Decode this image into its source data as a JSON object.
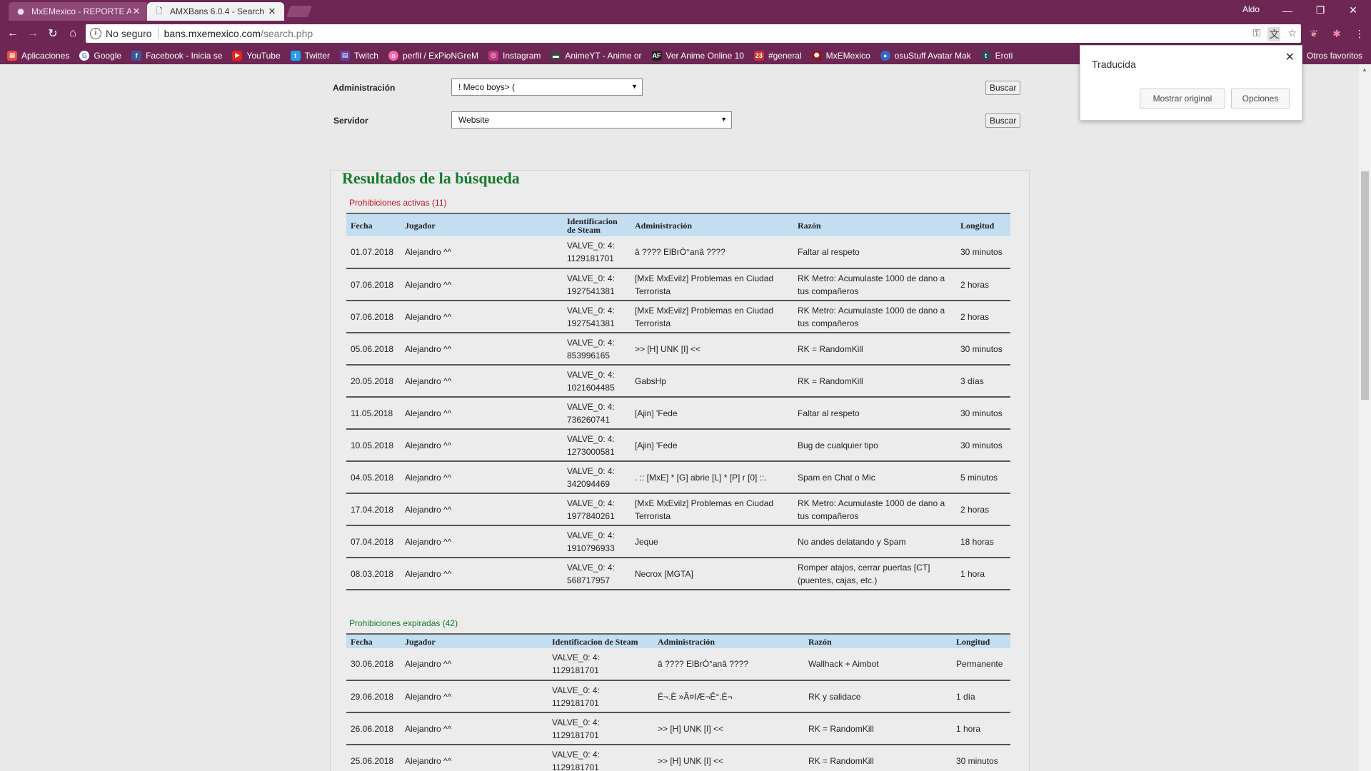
{
  "browser": {
    "tabs": [
      {
        "title": "MxEMexico - REPORTE A",
        "active": false
      },
      {
        "title": "AMXBans 6.0.4 - Search",
        "active": true
      }
    ],
    "profile_name": "Aldo",
    "security_label": "No seguro",
    "url_host": "bans.mxemexico.com",
    "url_path": "/search.php",
    "bookmarks": [
      {
        "label": "Aplicaciones",
        "icon": "apps-icon",
        "color": "#e94b3c"
      },
      {
        "label": "Google",
        "icon": "google-icon",
        "color": "#4285f4"
      },
      {
        "label": "Facebook - Inicia se",
        "icon": "facebook-icon",
        "color": "#3b5998"
      },
      {
        "label": "YouTube",
        "icon": "youtube-icon",
        "color": "#e62117"
      },
      {
        "label": "Twitter",
        "icon": "twitter-icon",
        "color": "#1da1f2"
      },
      {
        "label": "Twitch",
        "icon": "twitch-icon",
        "color": "#6441a4"
      },
      {
        "label": "perfil / ExPioNGreM",
        "icon": "osu-icon",
        "color": "#ff66aa"
      },
      {
        "label": "Instagram",
        "icon": "instagram-icon",
        "color": "#c13584"
      },
      {
        "label": "AnimeYT - Anime or",
        "icon": "animeyt-icon",
        "color": "#444444"
      },
      {
        "label": "Ver Anime Online 10",
        "icon": "animeflv-icon",
        "color": "#222222"
      },
      {
        "label": "#general",
        "icon": "discord-icon",
        "color": "#c83232"
      },
      {
        "label": "MxEMexico",
        "icon": "mxe-icon",
        "color": "#8b1a1a"
      },
      {
        "label": "osuStuff Avatar Mak",
        "icon": "osustuff-icon",
        "color": "#3366cc"
      },
      {
        "label": "Eroti",
        "icon": "tumblr-icon",
        "color": "#35465c"
      }
    ],
    "other_bookmarks": "Otros favoritos"
  },
  "translate_popup": {
    "title": "Traducida",
    "show_original": "Mostrar original",
    "options": "Opciones"
  },
  "search_form": {
    "admin_label": "Administración",
    "admin_value": "! Meco boys> (",
    "server_label": "Servidor",
    "server_value": "Website",
    "search_button": "Buscar"
  },
  "results": {
    "title": "Resultados de la búsqueda",
    "active_title": "Prohibiciones activas (11)",
    "expired_title": "Prohibiciones expiradas (42)",
    "active_headers": [
      "Fecha",
      "Jugador",
      "Identificacion de Steam",
      "Administración",
      "Razón",
      "Longitud"
    ],
    "expired_headers": [
      "Fecha",
      "Jugador",
      "Identificacion de Steam",
      "Administración",
      "Razón",
      "Longitud"
    ],
    "active_rows": [
      [
        "01.07.2018",
        "Alejandro ^^",
        "VALVE_0: 4: 1129181701",
        "â ???? ElBrÒ°anâ ????",
        "Faltar al respeto",
        "30 minutos"
      ],
      [
        "07.06.2018",
        "Alejandro ^^",
        "VALVE_0: 4: 1927541381",
        "[MxE MxEvilz] Problemas en Ciudad Terrorista",
        "RK Metro: Acumulaste 1000 de dano a tus compañeros",
        "2 horas"
      ],
      [
        "07.06.2018",
        "Alejandro ^^",
        "VALVE_0: 4: 1927541381",
        "[MxE MxEvilz] Problemas en Ciudad Terrorista",
        "RK Metro: Acumulaste 1000 de dano a tus compañeros",
        "2 horas"
      ],
      [
        "05.06.2018",
        "Alejandro ^^",
        "VALVE_0: 4: 853996165",
        ">> [H] UNK [I] <<",
        "RK = RandomKill",
        "30 minutos"
      ],
      [
        "20.05.2018",
        "Alejandro ^^",
        "VALVE_0: 4: 1021604485",
        "GabsHp",
        "RK = RandomKill",
        "3 días"
      ],
      [
        "11.05.2018",
        "Alejandro ^^",
        "VALVE_0: 4: 736260741",
        "[Ajin] 'Fede",
        "Faltar al respeto",
        "30 minutos"
      ],
      [
        "10.05.2018",
        "Alejandro ^^",
        "VALVE_0: 4: 1273000581",
        "[Ajin] 'Fede",
        "Bug de cualquier tipo",
        "30 minutos"
      ],
      [
        "04.05.2018",
        "Alejandro ^^",
        "VALVE_0: 4: 342094469",
        ". :: [MxE] * [G] abrie [L] * [P] r [0] ::.",
        "Spam en Chat o Mic",
        "5 minutos"
      ],
      [
        "17.04.2018",
        "Alejandro ^^",
        "VALVE_0: 4: 1977840261",
        "[MxE MxEvilz] Problemas en Ciudad Terrorista",
        "RK Metro: Acumulaste 1000 de dano a tus compañeros",
        "2 horas"
      ],
      [
        "07.04.2018",
        "Alejandro ^^",
        "VALVE_0: 4: 1910796933",
        "Jeque",
        "No andes delatando y Spam",
        "18 horas"
      ],
      [
        "08.03.2018",
        "Alejandro ^^",
        "VALVE_0: 4: 568717957",
        "Necrox [MGTA]",
        "Romper atajos, cerrar puertas [CT] (puentes, cajas, etc.)",
        "1 hora"
      ]
    ],
    "expired_rows": [
      [
        "30.06.2018",
        "Alejandro ^^",
        "VALVE_0: 4: 1129181701",
        "â ???? ElBrÒ°anâ ????",
        "Wallhack + Aimbot",
        "Permanente"
      ],
      [
        "29.06.2018",
        "Alejandro ^^",
        "VALVE_0: 4: 1129181701",
        "É¬.È »Ã¤IÆ¬Ê°.É¬",
        "RK y salidace",
        "1 día"
      ],
      [
        "26.06.2018",
        "Alejandro ^^",
        "VALVE_0: 4: 1129181701",
        ">> [H] UNK [I] <<",
        "RK = RandomKill",
        "1 hora"
      ],
      [
        "25.06.2018",
        "Alejandro ^^",
        "VALVE_0: 4: 1129181701",
        ">> [H] UNK [I] <<",
        "RK = RandomKill",
        "30 minutos"
      ]
    ]
  }
}
